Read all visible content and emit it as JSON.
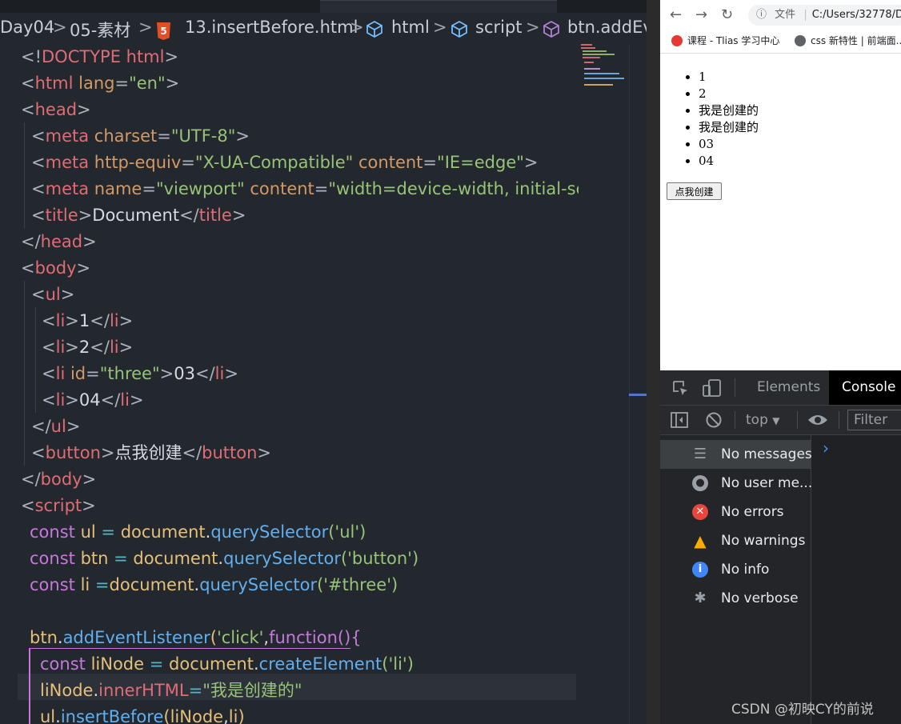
{
  "editor": {
    "breadcrumb": {
      "items": [
        "Day04",
        "05-素材",
        "13.insertBefore.html",
        "html",
        "script",
        "btn.addEv"
      ],
      "sep": ">",
      "h5_badge": "5"
    },
    "lines": [
      "<!DOCTYPE html>",
      "<html lang=\"en\">",
      "<head>",
      "<meta charset=\"UTF-8\">",
      "<meta http-equiv=\"X-UA-Compatible\" content=\"IE=edge\">",
      "<meta name=\"viewport\" content=\"width=device-width, initial-sc",
      "<title>Document</title>",
      "</head>",
      "<body>",
      "<ul>",
      "<li>1</li>",
      "<li>2</li>",
      "<li id=\"three\">03</li>",
      "<li>04</li>",
      "</ul>",
      "<button>点我创建</button>",
      "</body>",
      "<script>",
      "const ul = document.querySelector('ul')",
      "const btn = document.querySelector('button')",
      "const li =document.querySelector('#three')",
      "",
      "btn.addEventListener('click',function(){",
      "const liNode = document.createElement('li')",
      "liNode.innerHTML=\"我是创建的\"",
      "ul.insertBefore(liNode,li)"
    ],
    "tokens": {
      "doctype_open": "<!",
      "doctype": "DOCTYPE html",
      "lt": "<",
      "gt": ">",
      "lt_slash": "</",
      "eq": "=",
      "html": "html",
      "lang": "lang",
      "en": "\"en\"",
      "head": "head",
      "meta": "meta",
      "charset": "charset",
      "utf8": "\"UTF-8\"",
      "http_equiv": "http-equiv",
      "xua": "\"X-UA-Compatible\"",
      "content": "content",
      "ie_edge": "\"IE=edge\"",
      "name": "name",
      "viewport": "\"viewport\"",
      "viewport_content": "\"width=device-width, initial-sc",
      "title": "title",
      "document": "Document",
      "body": "body",
      "ul": "ul",
      "li": "li",
      "id": "id",
      "three": "\"three\"",
      "v1": "1",
      "v2": "2",
      "v03": "03",
      "v04": "04",
      "button": "button",
      "btn_text": "点我创建",
      "script": "script",
      "const": "const",
      "ul_var": "ul",
      "btn_var": "btn",
      "li_var": "li",
      "assign": " = ",
      "assign_tight": " =",
      "doc_obj": "document",
      "dot": ".",
      "qs": "querySelector",
      "arg_ul": "('ul')",
      "arg_button": "('button')",
      "arg_three": "('#three')",
      "add_listener": "addEventListener",
      "paren_open": "(",
      "click": "'click'",
      "comma": ",",
      "function": "function",
      "fn_end": "(){",
      "linode": "liNode",
      "create_el": "createElement",
      "arg_li": "('li')",
      "inner_html": "innerHTML",
      "eq_tight": "=",
      "created_str": "\"我是创建的\"",
      "insert_before": "insertBefore",
      "paren_close": ")"
    }
  },
  "browser": {
    "nav": {
      "back": "←",
      "forward": "→",
      "reload": "↻"
    },
    "info_icon": "ⓘ",
    "url_prefix": "文件",
    "url": "C:/Users/32778/D",
    "bookmarks": [
      {
        "label": "课程 - Tlias 学习中心",
        "color": "#e53935"
      },
      {
        "label": "css 新特性 | 前端面...",
        "color": "#5f6368"
      }
    ],
    "page": {
      "list": [
        "1",
        "2",
        "我是创建的",
        "我是创建的",
        "03",
        "04"
      ],
      "button_label": "点我创建"
    }
  },
  "devtools": {
    "tabs": [
      "Elements",
      "Console"
    ],
    "active_tab": "Console",
    "context": "top",
    "filter_placeholder": "Filter",
    "sidebar": [
      {
        "label": "No messages",
        "icon": "list-icon",
        "color": "#9aa0a6",
        "selected": true
      },
      {
        "label": "No user me...",
        "icon": "user-icon",
        "color": "#9aa0a6",
        "selected": false
      },
      {
        "label": "No errors",
        "icon": "error-icon",
        "color": "#e8453c",
        "selected": false
      },
      {
        "label": "No warnings",
        "icon": "warning-icon",
        "color": "#f9ab00",
        "selected": false
      },
      {
        "label": "No info",
        "icon": "info-icon",
        "color": "#4285f4",
        "selected": false
      },
      {
        "label": "No verbose",
        "icon": "bug-icon",
        "color": "#9aa0a6",
        "selected": false
      }
    ],
    "prompt": "›"
  },
  "watermark": "CSDN @初映CY的前说"
}
